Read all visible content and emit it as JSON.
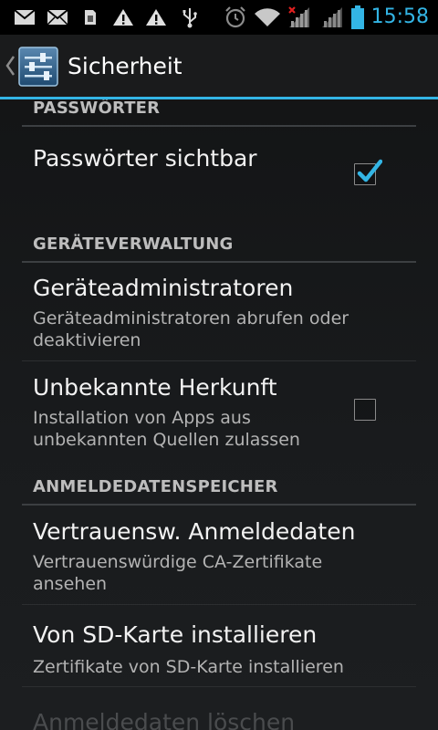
{
  "status_bar": {
    "time": "15:58",
    "icons": [
      "gmail-icon",
      "email-icon",
      "sim-card-icon",
      "warning-icon",
      "warning-icon",
      "usb-icon",
      "alarm-icon",
      "wifi-icon",
      "signal-no-service-icon",
      "signal-icon",
      "battery-icon"
    ],
    "accent": "#33b5e5"
  },
  "action_bar": {
    "title": "Sicherheit",
    "icon": "settings-icon"
  },
  "sections": [
    {
      "header": "PASSWÖRTER",
      "items": [
        {
          "title": "Passwörter sichtbar",
          "summary": "",
          "checkbox": true,
          "checked": true
        }
      ]
    },
    {
      "header": "GERÄTEVERWALTUNG",
      "items": [
        {
          "title": "Geräteadministratoren",
          "summary": "Geräteadministratoren abrufen oder deaktivieren",
          "checkbox": false
        },
        {
          "title": "Unbekannte Herkunft",
          "summary": "Installation von Apps aus unbekannten Quellen zulassen",
          "checkbox": true,
          "checked": false
        }
      ]
    },
    {
      "header": "ANMELDEDATENSPEICHER",
      "items": [
        {
          "title": "Vertrauensw. Anmeldedaten",
          "summary": "Vertrauenswürdige CA-Zertifikate ansehen",
          "checkbox": false
        },
        {
          "title": "Von SD-Karte installieren",
          "summary": "Zertifikate von SD-Karte installieren",
          "checkbox": false
        },
        {
          "title": "Anmeldedaten löschen",
          "summary": "",
          "checkbox": false,
          "disabled": true
        }
      ]
    }
  ]
}
